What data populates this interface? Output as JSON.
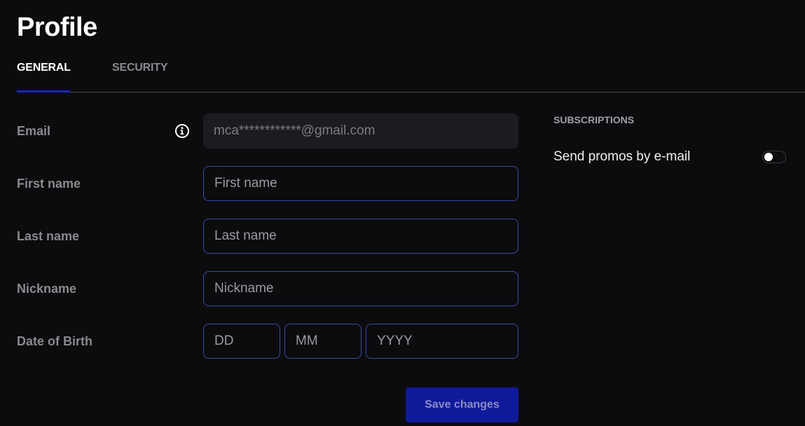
{
  "page": {
    "title": "Profile"
  },
  "tabs": [
    {
      "label": "GENERAL",
      "active": true
    },
    {
      "label": "SECURITY",
      "active": false
    }
  ],
  "form": {
    "email": {
      "label": "Email",
      "value": "mca************@gmail.com",
      "info_icon": "info-circle-icon"
    },
    "first_name": {
      "label": "First name",
      "placeholder": "First name"
    },
    "last_name": {
      "label": "Last name",
      "placeholder": "Last name"
    },
    "nickname": {
      "label": "Nickname",
      "placeholder": "Nickname"
    },
    "dob": {
      "label": "Date of Birth",
      "day_placeholder": "DD",
      "month_placeholder": "MM",
      "year_placeholder": "YYYY"
    },
    "save_label": "Save changes"
  },
  "subscriptions": {
    "heading": "SUBSCRIPTIONS",
    "items": [
      {
        "label": "Send promos by e-mail",
        "enabled": false
      }
    ]
  },
  "colors": {
    "accent": "#1a24c8",
    "button_bg": "#0f1a9a",
    "background": "#0c0c0e",
    "input_border": "#3a4aa8"
  }
}
